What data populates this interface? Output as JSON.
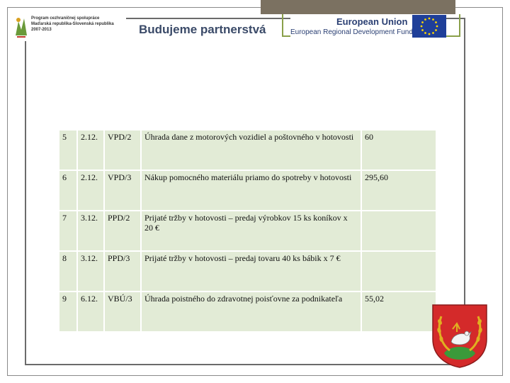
{
  "header": {
    "program_lines": [
      "Program cezhraničnej spolupráce",
      "Maďarská republika-Slovenská republika",
      "2007-2013"
    ],
    "slogan": "Budujeme partnerstvá",
    "eu_title": "European Union",
    "eu_subtitle": "European Regional Development Fund"
  },
  "colors": {
    "cell_background": "#e2ebd6",
    "frame_accent": "#8aa04a",
    "corner_dark": "#7b7161",
    "eu_blue": "#2a3f73"
  },
  "table": {
    "rows": [
      {
        "num": "5",
        "date": "2.12.",
        "doc": "VPD/2",
        "desc": "Úhrada dane z motorových vozidiel a poštovného v hotovosti",
        "amount": "60"
      },
      {
        "num": "6",
        "date": "2.12.",
        "doc": "VPD/3",
        "desc": "Nákup pomocného materiálu priamo do spotreby v hotovosti",
        "amount": "295,60"
      },
      {
        "num": "7",
        "date": "3.12.",
        "doc": "PPD/2",
        "desc": "Prijaté tržby v hotovosti – predaj výrobkov 15 ks koníkov x 20 €",
        "amount": ""
      },
      {
        "num": "8",
        "date": "3.12.",
        "doc": "PPD/3",
        "desc": "Prijaté tržby v hotovosti – predaj tovaru 40 ks bábik x 7 €",
        "amount": ""
      },
      {
        "num": "9",
        "date": "6.12.",
        "doc": "VBÚ/3",
        "desc": "Úhrada poistného do zdravotnej poisťovne za podnikateľa",
        "amount": "55,02"
      }
    ]
  },
  "icons": {
    "program_logo": "program-logo-icon",
    "eu_flag": "eu-flag-icon",
    "crest": "coat-of-arms-icon"
  }
}
